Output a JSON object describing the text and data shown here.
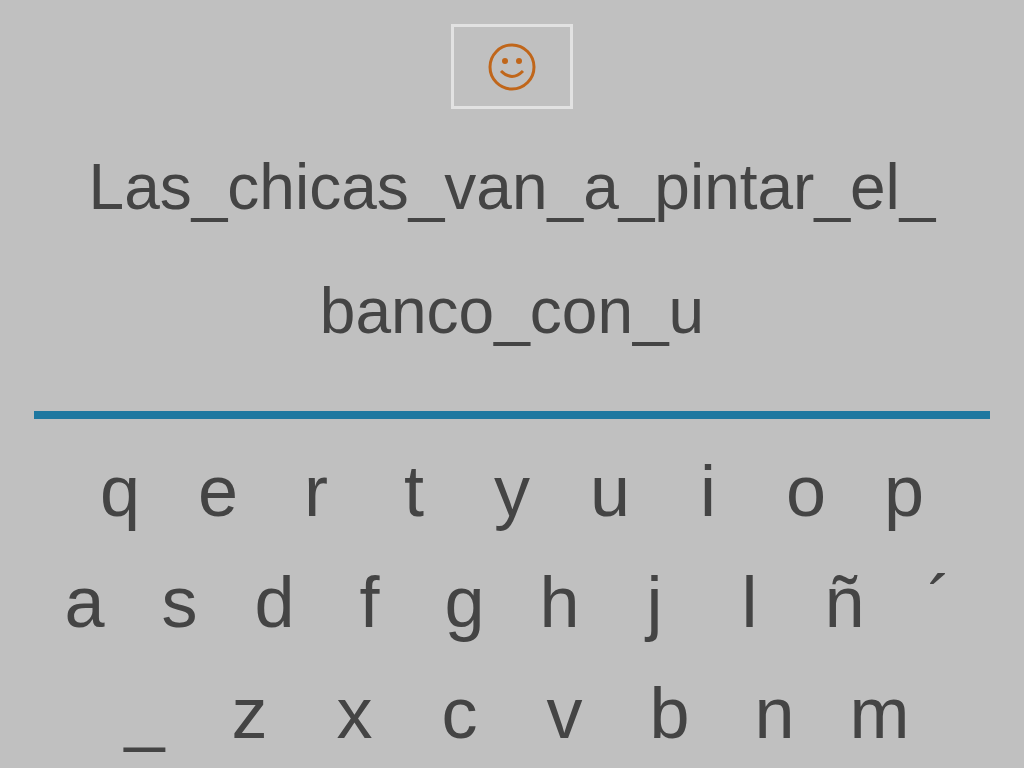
{
  "sentence_lines": [
    "Las_chicas_van_a_pintar_el_",
    "banco_con_u"
  ],
  "keyboard_rows": [
    [
      "q",
      "e",
      "r",
      "t",
      "y",
      "u",
      "i",
      "o",
      "p"
    ],
    [
      "a",
      "s",
      "d",
      "f",
      "g",
      "h",
      "j",
      "l",
      "ñ",
      "´"
    ],
    [
      "_",
      "z",
      "x",
      "c",
      "v",
      "b",
      "n",
      "m"
    ]
  ]
}
